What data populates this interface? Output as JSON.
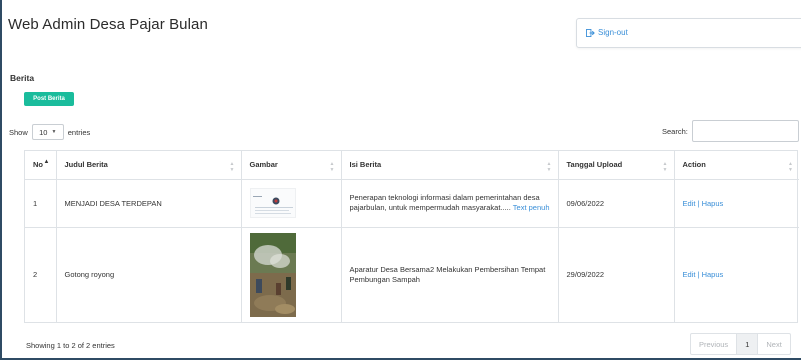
{
  "app": {
    "title": "Web Admin Desa Pajar Bulan"
  },
  "header": {
    "signout_label": "Sign-out"
  },
  "section": {
    "title": "Berita",
    "post_button": "Post Berita"
  },
  "table_controls": {
    "show_label": "Show",
    "page_length": "10",
    "entries_label": "entries",
    "search_label": "Search:"
  },
  "table": {
    "columns": [
      "No",
      "Judul Berita",
      "Gambar",
      "Isi Berita",
      "Tanggal Upload",
      "Action"
    ],
    "rows": [
      {
        "no": "1",
        "judul": "MENJADI DESA TERDEPAN",
        "isi": "Penerapan teknologi informasi dalam pemerintahan desa pajarbulan, untuk mempermudah masyarakat.....",
        "isi_link": "Text penuh",
        "tanggal": "09/06/2022",
        "edit": "Edit",
        "sep": "|",
        "hapus": "Hapus"
      },
      {
        "no": "2",
        "judul": "Gotong royong",
        "isi": "Aparatur Desa Bersama2 Melakukan Pembersihan Tempat Pembungan Sampah",
        "tanggal": "29/09/2022",
        "edit": "Edit",
        "sep": "|",
        "hapus": "Hapus"
      }
    ]
  },
  "footer": {
    "info": "Showing 1 to 2 of 2 entries",
    "previous": "Previous",
    "page": "1",
    "next": "Next"
  },
  "colors": {
    "accent": "#1abc9c",
    "link": "#3a8fd8",
    "frame": "#2f4b64"
  }
}
